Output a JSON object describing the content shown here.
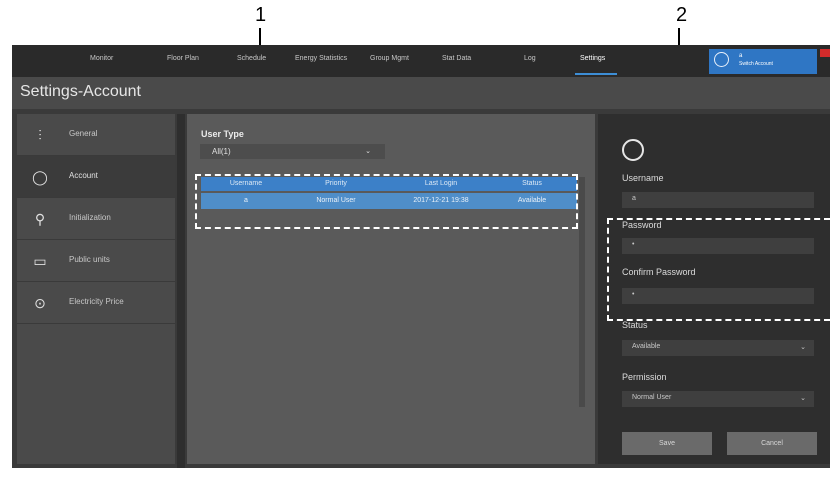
{
  "callouts": {
    "one": "1",
    "two": "2"
  },
  "nav": {
    "items": [
      "Monitor",
      "Floor Plan",
      "Schedule",
      "Energy Statistics",
      "Group Mgmt",
      "Stat Data",
      "Log",
      "Settings"
    ],
    "active": "Settings"
  },
  "account_box": {
    "name": "a",
    "switch_label": "Switch Account"
  },
  "page_title": "Settings-Account",
  "sidebar": {
    "items": [
      {
        "label": "General",
        "icon": "sliders-icon"
      },
      {
        "label": "Account",
        "icon": "user-circle-icon"
      },
      {
        "label": "Initialization",
        "icon": "search-user-icon"
      },
      {
        "label": "Public units",
        "icon": "units-icon"
      },
      {
        "label": "Electricity Price",
        "icon": "price-icon"
      }
    ],
    "active": "Account"
  },
  "main": {
    "user_type_label": "User Type",
    "user_type_value": "All(1)",
    "table": {
      "headers": [
        "Username",
        "Priority",
        "Last Login",
        "Status"
      ],
      "rows": [
        [
          "a",
          "Normal User",
          "2017-12-21 19:38",
          "Available"
        ]
      ]
    }
  },
  "right_panel": {
    "username_label": "Username",
    "username_value": "a",
    "password_label": "Password",
    "password_value": "•",
    "confirm_label": "Confirm Password",
    "confirm_value": "•",
    "status_label": "Status",
    "status_value": "Available",
    "permission_label": "Permission",
    "permission_value": "Normal User",
    "save_label": "Save",
    "cancel_label": "Cancel"
  },
  "colors": {
    "accent": "#3c80c8",
    "selected_row": "#4f8ec9",
    "account_box": "#2f76c4",
    "close_red": "#d22b2b"
  }
}
